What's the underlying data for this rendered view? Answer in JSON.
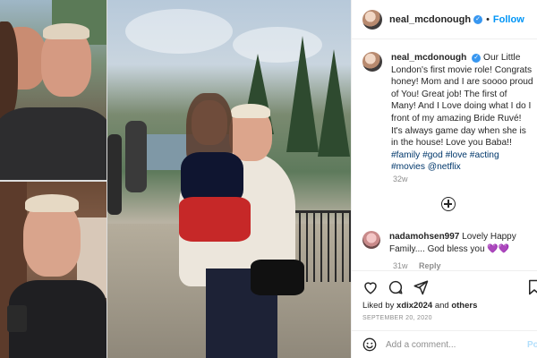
{
  "header": {
    "username": "neal_mcdonough",
    "separator": "•",
    "follow_label": "Follow"
  },
  "caption": {
    "username": "neal_mcdonough",
    "text": "Our Little London's first movie role! Congrats honey! Mom and I are soooo proud of You! Great job! The first of Many! And I Love doing what I do I front of my amazing Bride Ruvé! It's always game day when she is in the house! Love you Baba!!",
    "hashtags": "#family #god #love #acting #movies @netflix",
    "age": "32w"
  },
  "comments": [
    {
      "username": "nadamohsen997",
      "text": "Lovely Happy Family.... God bless you",
      "emoji": "💜💜",
      "age": "31w",
      "reply_label": "Reply"
    }
  ],
  "actions": {
    "like_icon": "heart-icon",
    "comment_icon": "comment-icon",
    "share_icon": "share-icon",
    "save_icon": "bookmark-icon"
  },
  "likes": {
    "prefix": "Liked by",
    "user": "xdix2024",
    "conjunction": "and",
    "others": "others"
  },
  "date": "SEPTEMBER 20, 2020",
  "add_comment": {
    "placeholder": "Add a comment...",
    "post_label": "Po"
  },
  "colors": {
    "accent": "#0095f6",
    "verified": "#3897f0",
    "hashtag": "#00376b",
    "muted": "#8e8e8e"
  }
}
